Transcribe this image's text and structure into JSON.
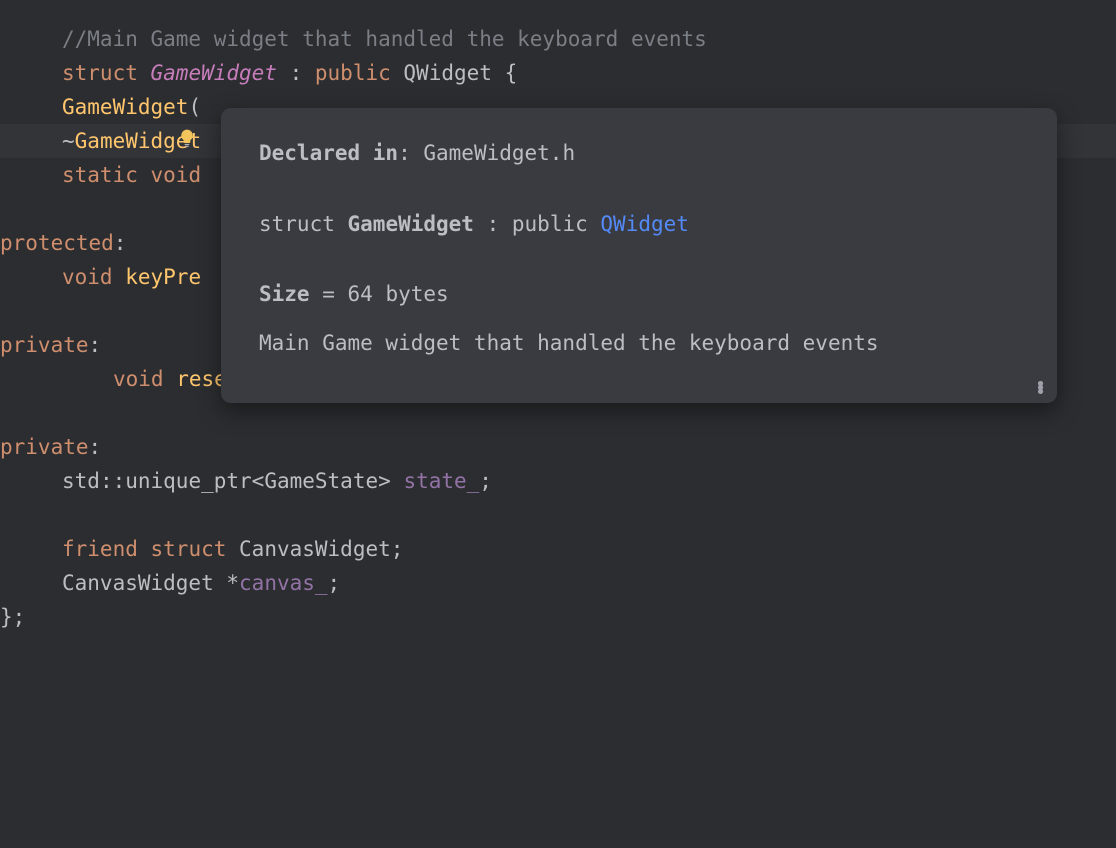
{
  "code": {
    "comment": "//Main Game widget that handled the keyboard events",
    "struct_kw": "struct",
    "class_name": "GameWidget",
    "colon_sp": " : ",
    "public_kw": "public",
    "base_class": "QWidget",
    "open_brace": " {",
    "ctor_name": "GameWidget",
    "ctor_paren": "(",
    "dtor_tilde": "~",
    "dtor_name": "GameWidget",
    "static_kw": "static",
    "void_kw": "void",
    "protected_kw": "protected",
    "colon": ":",
    "keypress_fn": "keyPre",
    "private_kw": "private",
    "resetstate_fn": "resetState",
    "empty_parens": "();",
    "std_ns": "std",
    "dcolon": "::",
    "unique_ptr": "unique_ptr",
    "lt": "<",
    "gamestate": "GameState",
    "gt": ">",
    "state_member": "state_",
    "semicolon": ";",
    "friend_kw": "friend",
    "canvaswidget": "CanvasWidget",
    "star": "*",
    "canvas_member": "canvas_",
    "close_brace": "};"
  },
  "tooltip": {
    "declared_label": "Declared in",
    "declared_sep": ": ",
    "declared_file": "GameWidget.h",
    "sig_struct": "struct ",
    "sig_name": "GameWidget",
    "sig_sep": " : ",
    "sig_public": "public ",
    "sig_base": "QWidget",
    "size_label": "Size",
    "size_eq": " = ",
    "size_value": "64 bytes",
    "description": "Main Game widget that handled the keyboard events"
  }
}
